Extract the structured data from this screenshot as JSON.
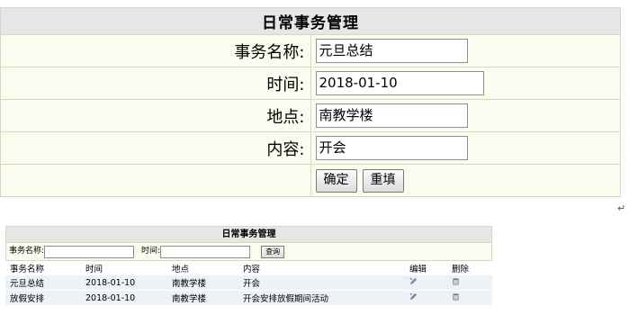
{
  "form": {
    "title": "日常事务管理",
    "fields": [
      {
        "label": "事务名称:",
        "value": "元旦总结"
      },
      {
        "label": "时间:",
        "value": "2018-01-10"
      },
      {
        "label": "地点:",
        "value": "南教学楼"
      },
      {
        "label": "内容:",
        "value": "开会"
      }
    ],
    "confirm_label": "确定",
    "reset_label": "重填"
  },
  "return_mark": "↵",
  "list": {
    "title": "日常事务管理",
    "search": {
      "name_label": "事务名称:",
      "time_label": "时间:",
      "query_label": "查询"
    },
    "columns": [
      "事务名称",
      "时间",
      "地点",
      "内容",
      "编辑",
      "删除"
    ],
    "rows": [
      {
        "name": "元旦总结",
        "time": "2018-01-10",
        "place": "南教学楼",
        "content": "开会"
      },
      {
        "name": "放假安排",
        "time": "2018-01-10",
        "place": "南教学楼",
        "content": "开会安排放假期间活动"
      }
    ],
    "icons": {
      "edit": "edit-icon",
      "delete": "trash-icon"
    }
  }
}
